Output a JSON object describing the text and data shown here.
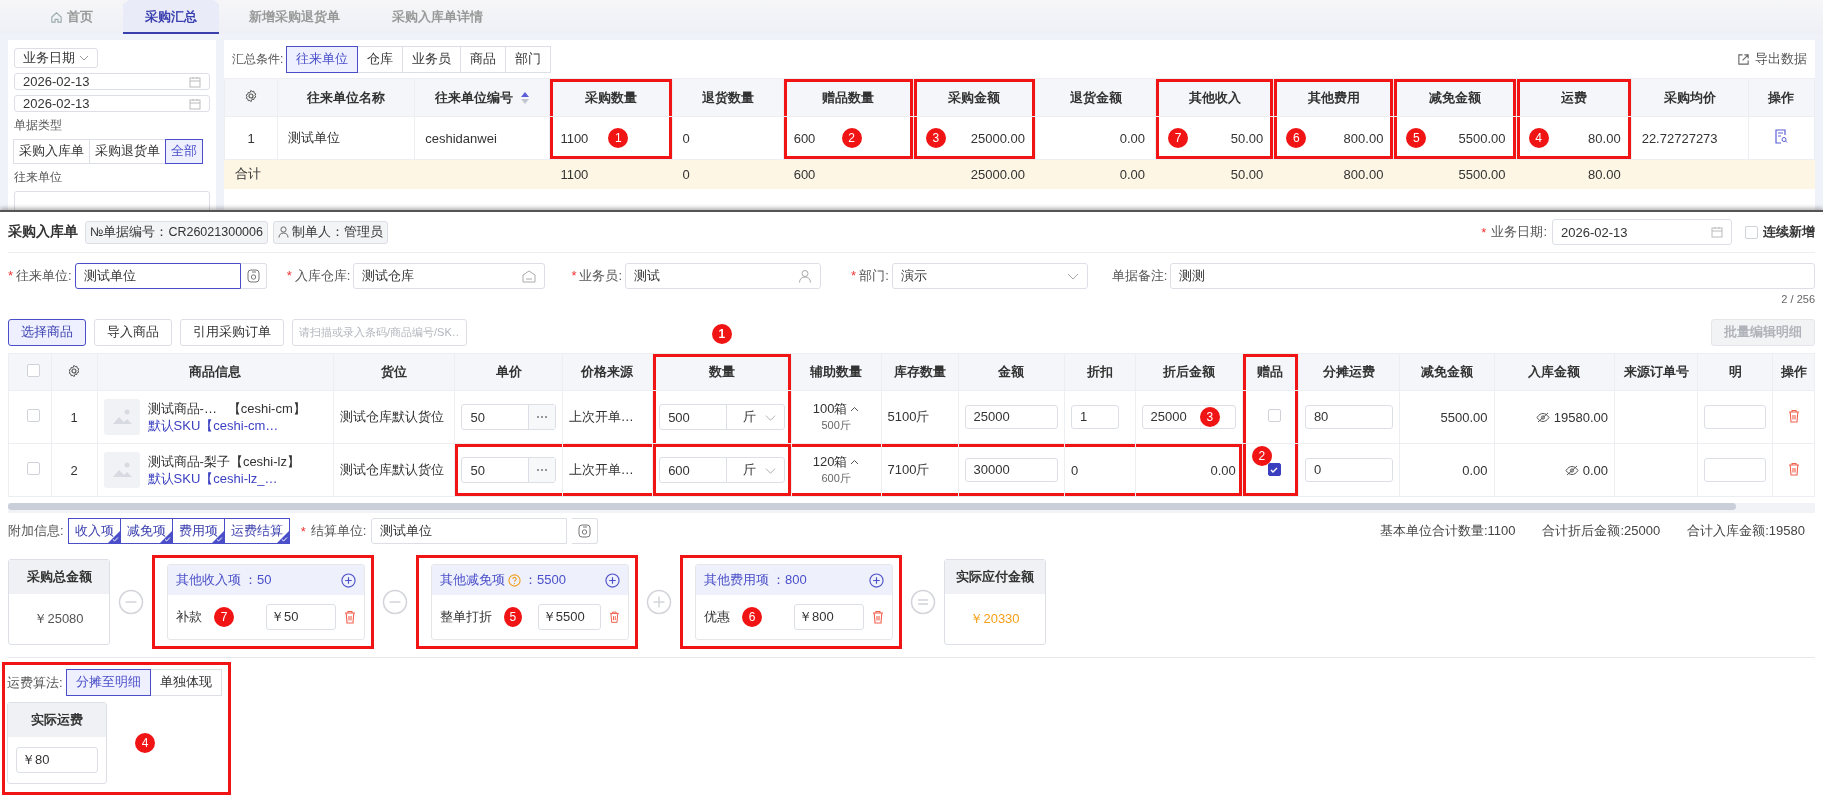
{
  "tabs": [
    {
      "label": "首页",
      "kind": "home",
      "selected": false
    },
    {
      "label": "采购汇总",
      "kind": "plain",
      "selected": true
    },
    {
      "label": "新增采购退货单",
      "kind": "plain",
      "selected": false
    },
    {
      "label": "采购入库单详情",
      "kind": "plain",
      "selected": false
    }
  ],
  "filters": {
    "date_type": "业务日期",
    "date_from": "2026-02-13",
    "date_to": "2026-02-13",
    "doc_type_label": "单据类型",
    "doc_types": [
      {
        "label": "采购入库单",
        "selected": false
      },
      {
        "label": "采购退货单",
        "selected": false
      },
      {
        "label": "全部",
        "selected": true
      }
    ],
    "partner_label": "往来单位"
  },
  "summary": {
    "group_label": "汇总条件:",
    "groups": [
      {
        "label": "往来单位",
        "selected": true
      },
      {
        "label": "仓库",
        "selected": false
      },
      {
        "label": "业务员",
        "selected": false
      },
      {
        "label": "商品",
        "selected": false
      },
      {
        "label": "部门",
        "selected": false
      }
    ],
    "export": "导出数据",
    "columns": [
      {
        "kind": "gear",
        "highlight": false,
        "sortable": false
      },
      {
        "kind": "text",
        "label": "往来单位名称",
        "highlight": false,
        "sortable": false
      },
      {
        "kind": "text",
        "label": "往来单位编号",
        "sortable": true,
        "highlight": false
      },
      {
        "kind": "text",
        "label": "采购数量",
        "highlight": true,
        "sortable": false
      },
      {
        "kind": "text",
        "label": "退货数量",
        "highlight": false,
        "sortable": false
      },
      {
        "kind": "text",
        "label": "赠品数量",
        "highlight": true,
        "sortable": false
      },
      {
        "kind": "amount",
        "label": "采购金额",
        "highlight": true,
        "sortable": false
      },
      {
        "kind": "amount",
        "label": "退货金额",
        "highlight": false,
        "sortable": false
      },
      {
        "kind": "amount",
        "label": "其他收入",
        "highlight": true,
        "sortable": false
      },
      {
        "kind": "amount",
        "label": "其他费用",
        "highlight": true,
        "sortable": false
      },
      {
        "kind": "amount",
        "label": "减免金额",
        "highlight": true,
        "sortable": false
      },
      {
        "kind": "amount",
        "label": "运费",
        "highlight": true,
        "sortable": false
      },
      {
        "kind": "text",
        "label": "采购均价",
        "highlight": false,
        "sortable": false
      },
      {
        "kind": "action",
        "label": "操作",
        "highlight": false,
        "sortable": false
      }
    ],
    "rows": [
      {
        "cells": [
          {
            "text": "1"
          },
          {
            "text": "测试单位"
          },
          {
            "text": "ceshidanwei"
          },
          {
            "text": "1100",
            "badge": "1"
          },
          {
            "text": "0"
          },
          {
            "text": "600",
            "badge": "2"
          },
          {
            "text": "25000.00",
            "badge": "3"
          },
          {
            "text": "0.00"
          },
          {
            "text": "50.00",
            "badge": "7"
          },
          {
            "text": "800.00",
            "badge": "6"
          },
          {
            "text": "5500.00",
            "badge": "5"
          },
          {
            "text": "80.00",
            "badge": "4"
          },
          {
            "text": "22.72727273"
          },
          {}
        ]
      }
    ],
    "total": {
      "label": "合计",
      "cells": [
        {},
        {},
        {},
        {
          "text": "1100"
        },
        {
          "text": "0"
        },
        {
          "text": "600"
        },
        {
          "text": "25000.00"
        },
        {
          "text": "0.00"
        },
        {
          "text": "50.00"
        },
        {
          "text": "800.00"
        },
        {
          "text": "5500.00"
        },
        {
          "text": "80.00"
        },
        {},
        {}
      ]
    }
  },
  "entry": {
    "title": "采购入库单",
    "doc_no": "№单据编号：CR26021300006",
    "maker": "制单人：管理员",
    "date_mark": "*",
    "date_label": "业务日期:",
    "date": "2026-02-13",
    "continuous": {
      "label": "连续新增",
      "checked": false
    },
    "fields": [
      {
        "mark": "*",
        "label": "往来单位:",
        "value": "测试单位",
        "kind": "lookup",
        "focused": true
      },
      {
        "mark": "*",
        "label": "入库仓库:",
        "value": "测试仓库",
        "kind": "warehouse",
        "focused": false
      },
      {
        "mark": "*",
        "label": "业务员:",
        "value": "测试",
        "kind": "person",
        "focused": false
      },
      {
        "mark": "*",
        "label": "部门:",
        "value": "演示",
        "kind": "dropdown",
        "focused": false
      },
      {
        "label": "单据备注:",
        "value": "测测",
        "kind": "plain",
        "focused": false,
        "counter": "2 / 256"
      }
    ],
    "buttons": [
      {
        "label": "选择商品",
        "primary": true
      },
      {
        "label": "导入商品",
        "primary": false
      },
      {
        "label": "引用采购订单",
        "primary": false
      }
    ],
    "scan_placeholder": "请扫描或录入条码/商品编号/SK…",
    "batch_edit": {
      "label": "批量编辑明细",
      "disabled": true
    }
  },
  "items": {
    "columns": [
      {
        "kind": "check",
        "checked": false,
        "highlight": false
      },
      {
        "kind": "gear",
        "highlight": false
      },
      {
        "kind": "label",
        "label": "商品信息",
        "highlight": false
      },
      {
        "kind": "label",
        "label": "货位",
        "highlight": false
      },
      {
        "kind": "label",
        "label": "单价",
        "highlight": false
      },
      {
        "kind": "label",
        "label": "价格来源",
        "highlight": false
      },
      {
        "kind": "label",
        "label": "数量",
        "highlight": true,
        "badge": "1"
      },
      {
        "kind": "label",
        "label": "辅助数量",
        "highlight": false
      },
      {
        "kind": "label",
        "label": "库存数量",
        "highlight": false
      },
      {
        "kind": "label",
        "label": "金额",
        "highlight": false
      },
      {
        "kind": "label",
        "label": "折扣",
        "highlight": false
      },
      {
        "kind": "label",
        "label": "折后金额",
        "highlight": false
      },
      {
        "kind": "label",
        "label": "赠品",
        "highlight": true
      },
      {
        "kind": "label",
        "label": "分摊运费",
        "highlight": false
      },
      {
        "kind": "label",
        "label": "减免金额",
        "highlight": false
      },
      {
        "kind": "label",
        "label": "入库金额",
        "highlight": false
      },
      {
        "kind": "label",
        "label": "来源订单号",
        "highlight": false
      },
      {
        "kind": "label",
        "label": "明",
        "highlight": false
      },
      {
        "kind": "label",
        "label": "操作",
        "highlight": false
      }
    ],
    "rows": [
      {
        "cells": [
          {
            "kind": "check",
            "checked": false
          },
          {
            "kind": "text",
            "text": "1"
          },
          {
            "kind": "product",
            "name": "测试商品-…",
            "code": "【ceshi-cm】",
            "sku": "默认SKU【ceshi-cm…"
          },
          {
            "kind": "text",
            "text": "测试仓库默认货位"
          },
          {
            "kind": "price",
            "value": "50"
          },
          {
            "kind": "text",
            "text": "上次开单…"
          },
          {
            "kind": "qty",
            "value": "500",
            "unit": "斤"
          },
          {
            "kind": "aux",
            "main": "100箱",
            "sub": "500斤"
          },
          {
            "kind": "text",
            "text": "5100斤"
          },
          {
            "kind": "input",
            "value": "25000"
          },
          {
            "kind": "input",
            "value": "1"
          },
          {
            "kind": "input",
            "value": "25000",
            "badge": "3"
          },
          {
            "kind": "check",
            "checked": false
          },
          {
            "kind": "input",
            "value": "80"
          },
          {
            "kind": "num",
            "text": "5500.00"
          },
          {
            "kind": "hidden",
            "text": "19580.00"
          },
          {
            "kind": "empty"
          },
          {
            "kind": "cut_input"
          },
          {
            "kind": "delete"
          }
        ]
      },
      {
        "cells": [
          {
            "kind": "check",
            "checked": false
          },
          {
            "kind": "text",
            "text": "2"
          },
          {
            "kind": "product",
            "name": "测试商品-梨子【ceshi-lz】",
            "sku": "默认SKU【ceshi-lz_…"
          },
          {
            "kind": "text",
            "text": "测试仓库默认货位"
          },
          {
            "kind": "price",
            "value": "50",
            "boxed": true
          },
          {
            "kind": "text",
            "text": "上次开单…",
            "boxed": true
          },
          {
            "kind": "qty",
            "value": "600",
            "unit": "斤",
            "boxed": true
          },
          {
            "kind": "aux",
            "main": "120箱",
            "sub": "600斤",
            "boxed": true
          },
          {
            "kind": "text",
            "text": "7100斤",
            "boxed": true
          },
          {
            "kind": "input",
            "value": "30000",
            "boxed": true
          },
          {
            "kind": "plain",
            "text": "0",
            "boxed": true
          },
          {
            "kind": "num",
            "text": "0.00",
            "boxed": true
          },
          {
            "kind": "check",
            "checked": true,
            "badge": "2"
          },
          {
            "kind": "input",
            "value": "0"
          },
          {
            "kind": "num",
            "text": "0.00"
          },
          {
            "kind": "hidden",
            "text": "0.00"
          },
          {
            "kind": "empty"
          },
          {
            "kind": "cut_input"
          },
          {
            "kind": "delete"
          }
        ]
      }
    ]
  },
  "extras": {
    "label": "附加信息:",
    "tags": [
      {
        "label": "收入项",
        "checked": true
      },
      {
        "label": "减免项",
        "checked": true
      },
      {
        "label": "费用项",
        "checked": true
      },
      {
        "label": "运费结算",
        "checked": true
      }
    ],
    "settle_mark": "*",
    "settle_label": "结算单位:",
    "settle_value": "测试单位",
    "totals": [
      {
        "label": "基本单位合计数量:",
        "value": "1100"
      },
      {
        "label": "合计折后金额:",
        "value": "25000"
      },
      {
        "label": "合计入库金额:",
        "value": "19580"
      }
    ]
  },
  "calc": {
    "total": {
      "title": "采购总金额",
      "amount": "￥25080"
    },
    "groups": [
      {
        "kind": "minus",
        "title": "其他收入项",
        "help": false,
        "sum": "：50",
        "badge": "7",
        "items": [
          {
            "name": "补款",
            "amount": "￥50"
          }
        ]
      },
      {
        "kind": "minus",
        "title": "其他减免项",
        "help": true,
        "sum": "：5500",
        "badge": "5",
        "items": [
          {
            "name": "整单打折",
            "amount": "￥5500"
          }
        ]
      },
      {
        "kind": "plus",
        "title": "其他费用项",
        "help": false,
        "sum": "：800",
        "badge": "6",
        "items": [
          {
            "name": "优惠",
            "amount": "￥800"
          }
        ]
      }
    ],
    "result": {
      "kind": "equals",
      "title": "实际应付金额",
      "amount": "￥20330"
    }
  },
  "freight": {
    "label": "运费算法:",
    "modes": [
      {
        "label": "分摊至明细",
        "selected": true
      },
      {
        "label": "单独体现",
        "selected": false
      }
    ],
    "card_title": "实际运费",
    "value": "￥80",
    "badge": "4"
  }
}
